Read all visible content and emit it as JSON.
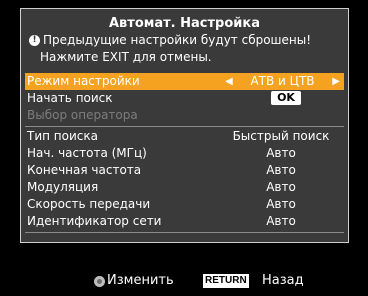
{
  "dialog": {
    "title": "Автомат. Настройка",
    "warning_line1": "Предыдущие настройки будут сброшены!",
    "warning_line2": "Нажмите EXIT для отмены."
  },
  "menu": {
    "mode_label": "Режим настройки",
    "mode_value": "АТВ и ЦТВ",
    "start_search_label": "Начать поиск",
    "ok_label": "OK",
    "operator_label": "Выбор оператора",
    "rows": [
      {
        "label": "Тип поиска",
        "value": "Быстрый поиск"
      },
      {
        "label": "Нач. частота (МГц)",
        "value": "Авто"
      },
      {
        "label": "Конечная частота",
        "value": "Авто"
      },
      {
        "label": "Модуляция",
        "value": "Авто"
      },
      {
        "label": "Скорость передачи",
        "value": "Авто"
      },
      {
        "label": "Идентификатор сети",
        "value": "Авто"
      }
    ]
  },
  "footer": {
    "change_label": "Изменить",
    "return_key": "RETURN",
    "back_label": "Назад"
  },
  "colors": {
    "highlight": "#f4a21f",
    "panel": "#3a3a3a"
  }
}
